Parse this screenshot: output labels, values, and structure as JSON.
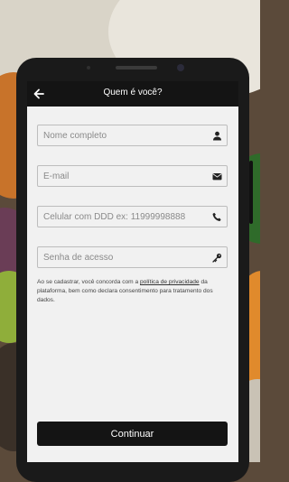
{
  "header": {
    "title": "Quem é você?"
  },
  "form": {
    "name_placeholder": "Nome completo",
    "email_placeholder": "E-mail",
    "phone_placeholder": "Celular com DDD ex: 11999998888",
    "password_placeholder": "Senha de acesso"
  },
  "consent": {
    "before": "Ao se cadastrar, você concorda com a ",
    "link": "política de privacidade",
    "after": " da plataforma, bem como declara consentimento para tratamento dos dados."
  },
  "actions": {
    "continue_label": "Continuar"
  },
  "icons": {
    "back": "arrow-left-icon",
    "name": "user-icon",
    "email": "envelope-icon",
    "phone": "phone-icon",
    "password": "key-icon"
  },
  "colors": {
    "appbar": "#141414",
    "button": "#141414",
    "screen": "#f1f1f1"
  }
}
